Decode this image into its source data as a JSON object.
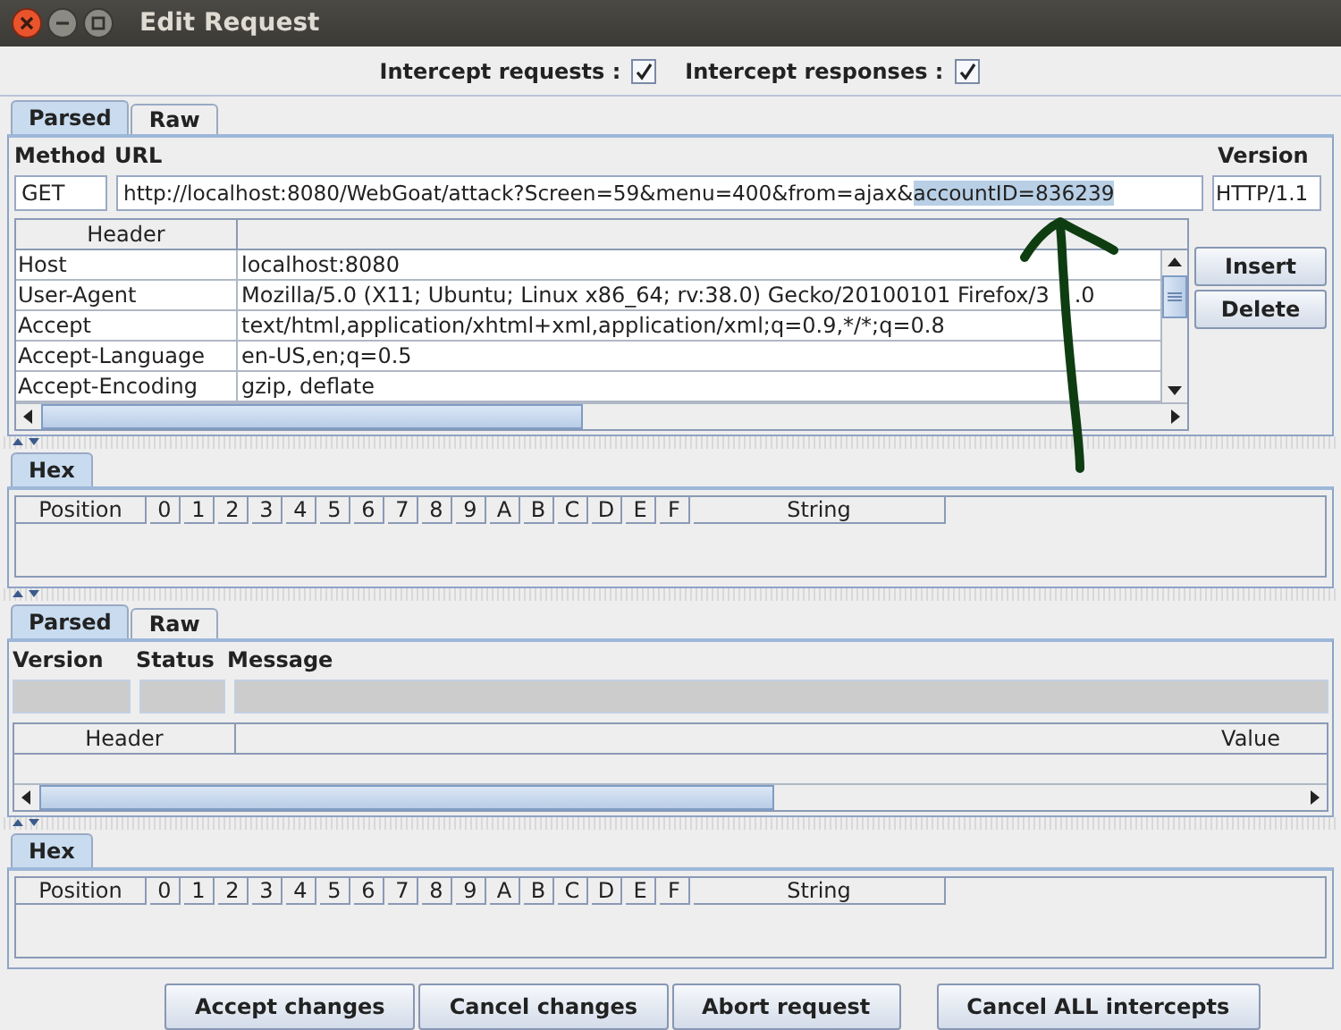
{
  "window": {
    "title": "Edit Request"
  },
  "intercept": [
    {
      "label": "Intercept requests :",
      "checked": true
    },
    {
      "label": "Intercept responses :",
      "checked": true
    }
  ],
  "request": {
    "tabs": [
      {
        "label": "Parsed",
        "selected": true
      },
      {
        "label": "Raw",
        "selected": false
      }
    ],
    "labels": {
      "method": "Method",
      "url": "URL",
      "version": "Version"
    },
    "method": "GET",
    "url": {
      "value": "http://localhost:8080/WebGoat/attack?Screen=59&menu=400&from=ajax&",
      "selected_text": "accountID=836239"
    },
    "version": "HTTP/1.1",
    "table": {
      "columns": [
        "Header"
      ],
      "rows": [
        {
          "header": "Host",
          "value": "localhost:8080"
        },
        {
          "header": "User-Agent",
          "value": "Mozilla/5.0 (X11; Ubuntu; Linux x86_64; rv:38.0) Gecko/20100101 Firefox/3",
          "value_tail": ".0"
        },
        {
          "header": "Accept",
          "value": "text/html,application/xhtml+xml,application/xml;q=0.9,*/*;q=0.8"
        },
        {
          "header": "Accept-Language",
          "value": "en-US,en;q=0.5"
        },
        {
          "header": "Accept-Encoding",
          "value": "gzip, deflate"
        }
      ]
    },
    "buttons": [
      "Insert",
      "Delete"
    ],
    "hex": {
      "tab": "Hex",
      "columns": [
        "Position",
        "0",
        "1",
        "2",
        "3",
        "4",
        "5",
        "6",
        "7",
        "8",
        "9",
        "A",
        "B",
        "C",
        "D",
        "E",
        "F",
        "String"
      ]
    }
  },
  "response": {
    "tabs": [
      {
        "label": "Parsed",
        "selected": true
      },
      {
        "label": "Raw",
        "selected": false
      }
    ],
    "labels": {
      "version": "Version",
      "status": "Status",
      "message": "Message"
    },
    "table": {
      "columns": [
        "Header",
        "Value"
      ]
    },
    "hex": {
      "tab": "Hex",
      "columns": [
        "Position",
        "0",
        "1",
        "2",
        "3",
        "4",
        "5",
        "6",
        "7",
        "8",
        "9",
        "A",
        "B",
        "C",
        "D",
        "E",
        "F",
        "String"
      ]
    }
  },
  "buttons": [
    "Accept changes",
    "Cancel changes",
    "Abort request",
    "Cancel ALL intercepts"
  ]
}
